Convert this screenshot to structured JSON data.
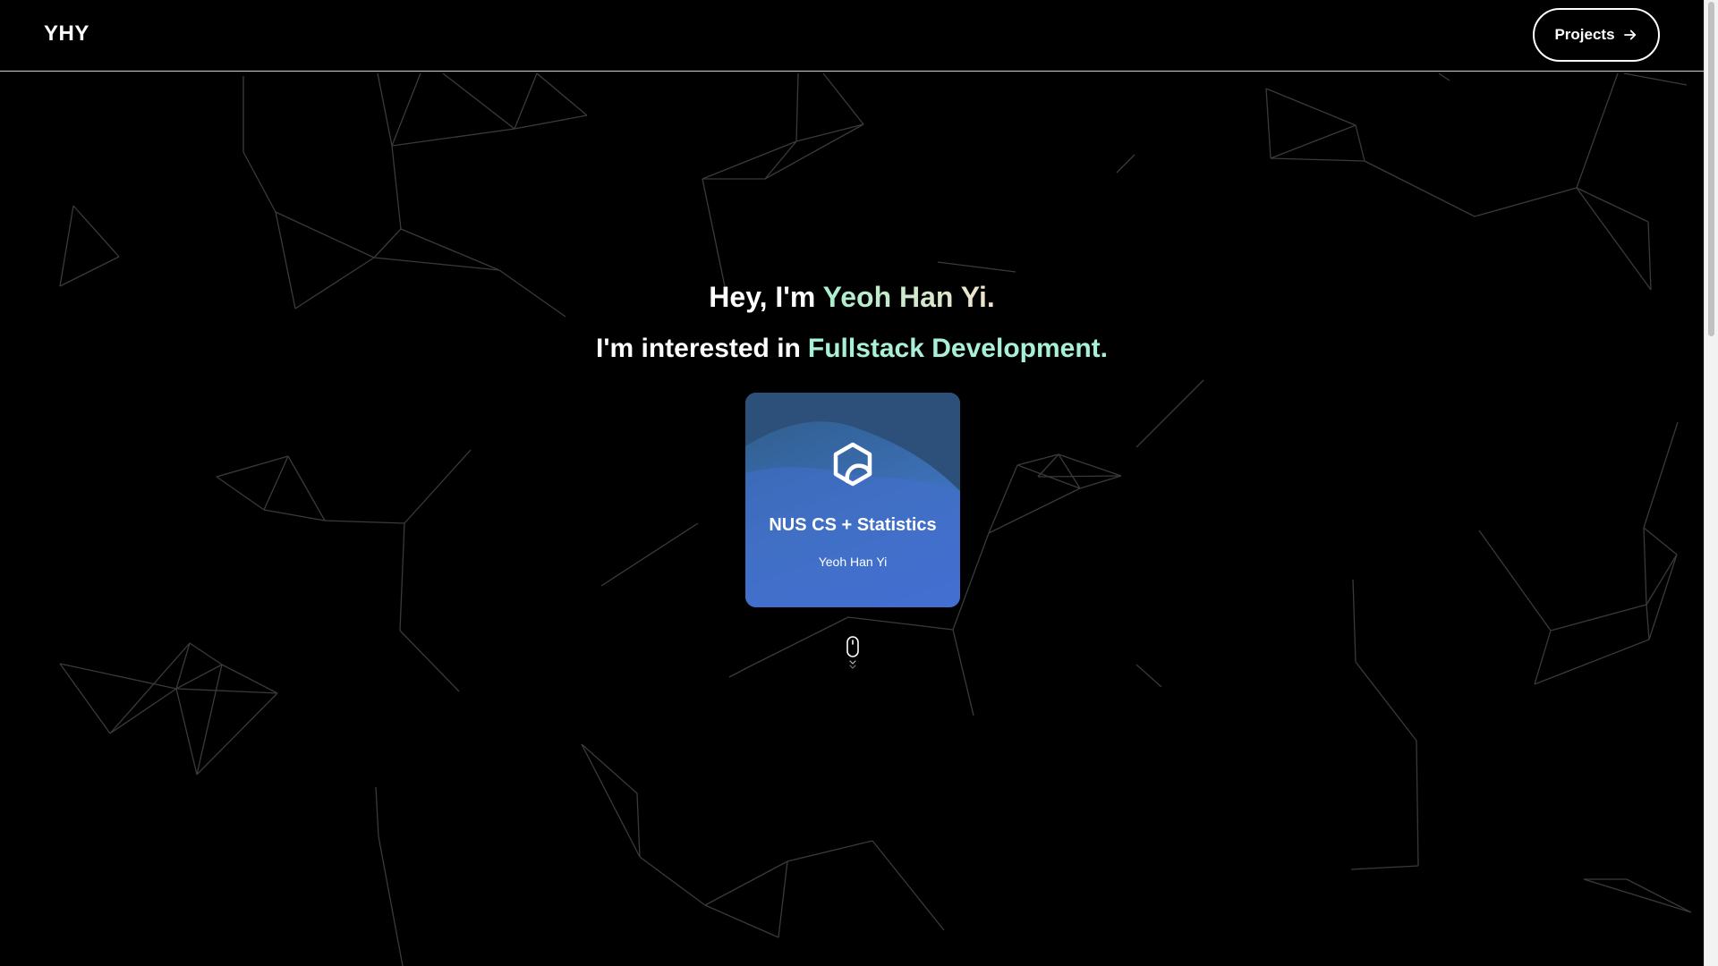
{
  "navbar": {
    "logo": "YHY",
    "projects_label": "Projects",
    "projects_icon": "arrow-right-icon"
  },
  "hero": {
    "greeting_prefix": "Hey, I'm ",
    "name": "Yeoh Han Yi.",
    "interest_prefix": "I'm interested in",
    "interest": "Fullstack Development."
  },
  "card": {
    "icon": "hexagon-logo-icon",
    "title": "NUS CS + Statistics",
    "subtitle": "Yeoh Han Yi"
  },
  "scroll_indicator": {
    "icon": "mouse-scroll-icon"
  },
  "colors": {
    "background": "#000000",
    "accent": "#a9f1d6",
    "card_gradient_start": "#2f5b86",
    "card_gradient_end": "#4470d6"
  }
}
